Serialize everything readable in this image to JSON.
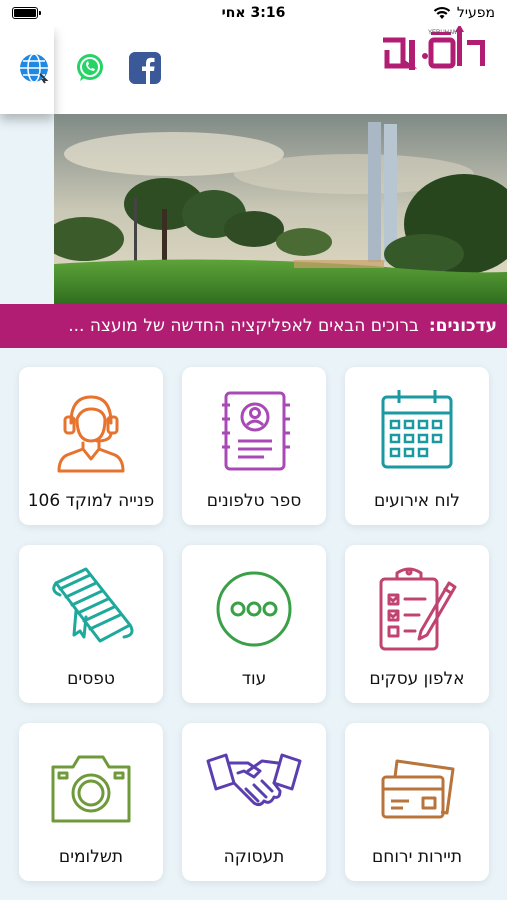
{
  "status_bar": {
    "carrier": "מפעיל",
    "time": "3:16 אחי"
  },
  "header": {
    "logo_text": "ירוחם",
    "logo_subtext": "YERUHAM",
    "social": [
      {
        "name": "facebook-icon",
        "color": "#3b5998"
      },
      {
        "name": "whatsapp-icon",
        "color": "#25d366"
      },
      {
        "name": "globe-icon",
        "color": "#1e88e5"
      }
    ]
  },
  "ticker": {
    "label": "עדכונים:",
    "text": "ברוכים הבאים לאפליקציה החדשה של מועצה ..."
  },
  "tiles": [
    {
      "label": "לוח אירועים",
      "icon": "calendar-icon",
      "color": "#1a9aa0"
    },
    {
      "label": "ספר טלפונים",
      "icon": "phonebook-icon",
      "color": "#a84ab5"
    },
    {
      "label": "פנייה למוקד 106",
      "icon": "call-center-agent-icon",
      "color": "#e6732e"
    },
    {
      "label": "אלפון עסקים",
      "icon": "clipboard-checklist-icon",
      "color": "#c0446f"
    },
    {
      "label": "עוד",
      "icon": "more-dots-icon",
      "color": "#3aa047"
    },
    {
      "label": "טפסים",
      "icon": "scroll-forms-icon",
      "color": "#1fa89c"
    },
    {
      "label": "תיירות ירוחם",
      "icon": "tickets-icon",
      "color": "#b8743a"
    },
    {
      "label": "תעסוקה",
      "icon": "handshake-icon",
      "color": "#5b3fb0"
    },
    {
      "label": "תשלומים",
      "icon": "camera-icon",
      "color": "#6e9a3a"
    }
  ]
}
